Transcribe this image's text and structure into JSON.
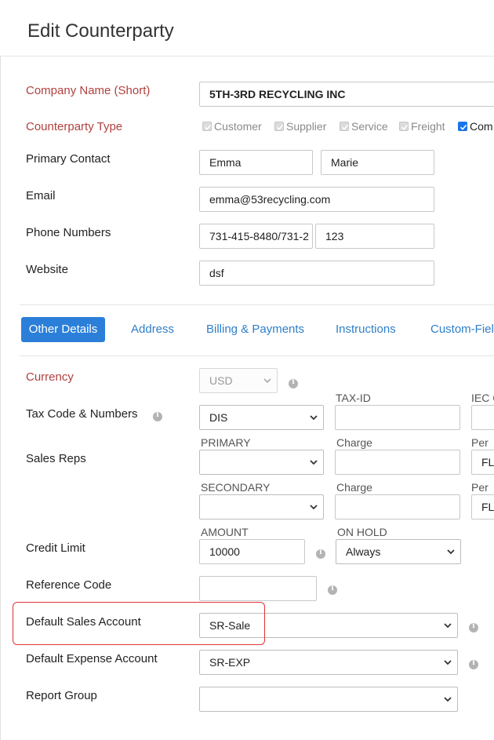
{
  "page": {
    "title": "Edit Counterparty"
  },
  "company": {
    "label": "Company Name (Short)",
    "value": "5TH-3RD RECYCLING INC"
  },
  "counterparty_type": {
    "label": "Counterparty Type",
    "options": [
      {
        "label": "Customer",
        "checked": true,
        "disabled": true
      },
      {
        "label": "Supplier",
        "checked": true,
        "disabled": true
      },
      {
        "label": "Service",
        "checked": true,
        "disabled": true
      },
      {
        "label": "Freight",
        "checked": true,
        "disabled": true
      },
      {
        "label": "Com",
        "checked": true,
        "disabled": false
      }
    ]
  },
  "primary_contact": {
    "label": "Primary Contact",
    "first": "Emma",
    "last": "Marie"
  },
  "email": {
    "label": "Email",
    "value": "emma@53recycling.com"
  },
  "phone": {
    "label": "Phone Numbers",
    "primary": "731-415-8480/731-2",
    "secondary": "123"
  },
  "website": {
    "label": "Website",
    "value": "dsf"
  },
  "tabs": [
    {
      "label": "Other Details",
      "active": true
    },
    {
      "label": "Address",
      "active": false
    },
    {
      "label": "Billing & Payments",
      "active": false
    },
    {
      "label": "Instructions",
      "active": false
    },
    {
      "label": "Custom-Field",
      "active": false
    }
  ],
  "currency": {
    "label": "Currency",
    "value": "USD"
  },
  "tax": {
    "label": "Tax Code & Numbers",
    "code": "DIS",
    "taxid_head": "TAX-ID",
    "taxid_value": "",
    "iec_head": "IEC C",
    "iec_value": ""
  },
  "sales_reps": {
    "label": "Sales Reps",
    "primary_head": "PRIMARY",
    "primary_value": "",
    "charge_head": "Charge",
    "charge_value": "",
    "per_head": "Per",
    "per_value": "FL",
    "secondary_head": "SECONDARY",
    "secondary_value": "",
    "charge2_head": "Charge",
    "charge2_value": "",
    "per2_head": "Per",
    "per2_value": "FL"
  },
  "credit": {
    "label": "Credit Limit",
    "amount_head": "AMOUNT",
    "amount": "10000",
    "onhold_head": "ON HOLD",
    "onhold": "Always"
  },
  "reference": {
    "label": "Reference Code",
    "value": ""
  },
  "default_sales": {
    "label": "Default Sales Account",
    "value": "SR-Sale"
  },
  "default_expense": {
    "label": "Default Expense Account",
    "value": "SR-EXP"
  },
  "report_group": {
    "label": "Report Group",
    "value": ""
  },
  "colors": {
    "accent": "#2b7fd9",
    "required_label": "#b0413e",
    "highlight": "#e0343a"
  }
}
